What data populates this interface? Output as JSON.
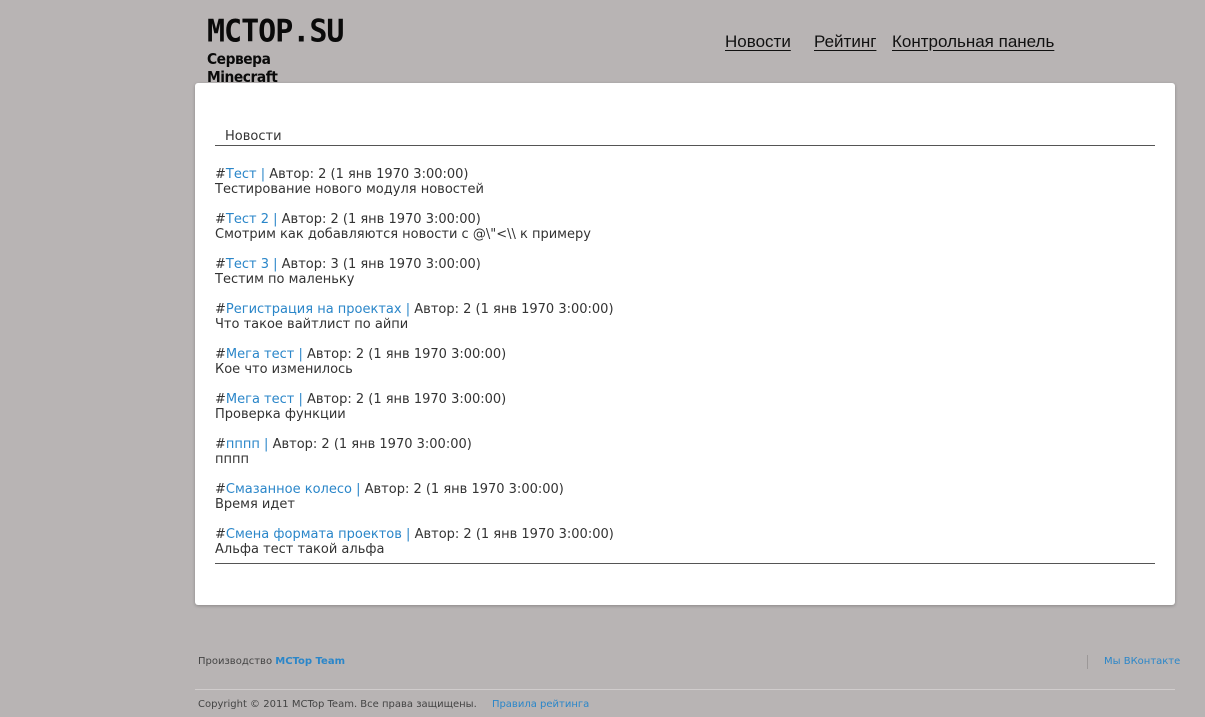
{
  "header": {
    "logo_main": "MCTOP.SU",
    "logo_sub": "Сервера Minecraft",
    "nav": [
      {
        "label": "Новости"
      },
      {
        "label": "Рейтинг"
      },
      {
        "label": "Контрольная панель"
      }
    ]
  },
  "main": {
    "section_title": "Новости",
    "news": [
      {
        "title": "Тест",
        "meta": "Автор: 2 (1 янв 1970 3:00:00)",
        "body": "Тестирование нового модуля новостей"
      },
      {
        "title": "Тест 2",
        "meta": "Автор: 2 (1 янв 1970 3:00:00)",
        "body": "Смотрим как добавляются новости с @\\\"<\\\\ к примеру"
      },
      {
        "title": "Тест 3",
        "meta": "Автор: 3 (1 янв 1970 3:00:00)",
        "body": "Тестим по маленьку"
      },
      {
        "title": "Регистрация на проектах",
        "meta": "Автор: 2 (1 янв 1970 3:00:00)",
        "body": "Что такое вайтлист по айпи"
      },
      {
        "title": "Мега тест",
        "meta": "Автор: 2 (1 янв 1970 3:00:00)",
        "body": "Кое что изменилось"
      },
      {
        "title": "Мега тест",
        "meta": "Автор: 2 (1 янв 1970 3:00:00)",
        "body": "Проверка функции"
      },
      {
        "title": "пппп",
        "meta": "Автор: 2 (1 янв 1970 3:00:00)",
        "body": "пппп"
      },
      {
        "title": "Смазанное колесо",
        "meta": "Автор: 2 (1 янв 1970 3:00:00)",
        "body": "Время идет"
      },
      {
        "title": "Смена формата проектов",
        "meta": "Автор: 2 (1 янв 1970 3:00:00)",
        "body": "Альфа тест такой альфа"
      }
    ],
    "hash": "#",
    "separator": "|"
  },
  "footer": {
    "made_by_prefix": "Производство",
    "made_by_link": "MCTop Team",
    "vk_link": "Мы ВКонтакте",
    "copyright": "Copyright © 2011 MCTop Team. Все права защищены.",
    "rules_link": "Правила рейтинга"
  },
  "colors": {
    "background": "#b8b4b4",
    "panel": "#ffffff",
    "link": "#2a86c9",
    "text": "#333333"
  }
}
